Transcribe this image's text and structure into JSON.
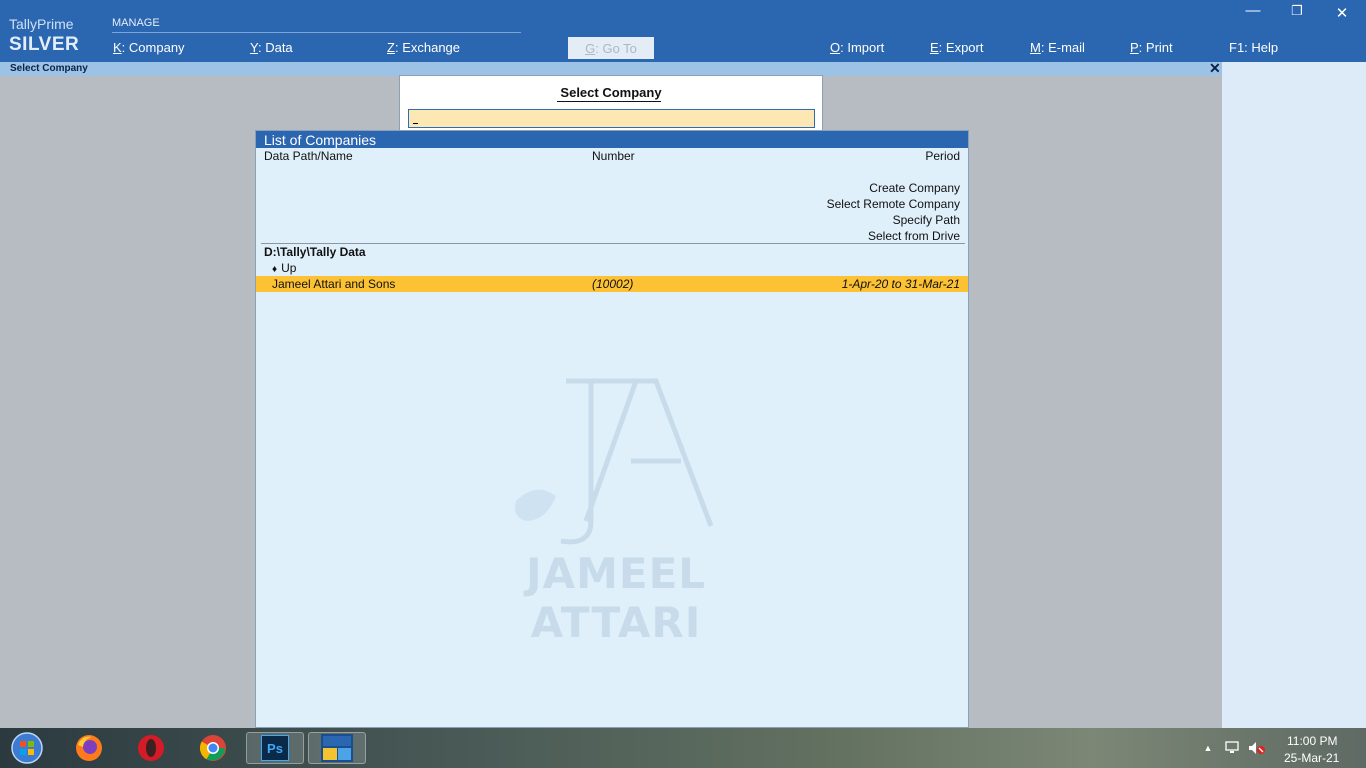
{
  "brand": {
    "product": "TallyPrime",
    "edition": "SILVER"
  },
  "topbar": {
    "section_label": "MANAGE",
    "menu": [
      {
        "key": "K",
        "label": "Company"
      },
      {
        "key": "Y",
        "label": "Data"
      },
      {
        "key": "Z",
        "label": "Exchange"
      },
      {
        "key": "G",
        "label": "Go To"
      },
      {
        "key": "O",
        "label": "Import"
      },
      {
        "key": "E",
        "label": "Export"
      },
      {
        "key": "M",
        "label": "E-mail"
      },
      {
        "key": "P",
        "label": "Print"
      },
      {
        "key": "F1",
        "label": "Help"
      }
    ],
    "window_controls": {
      "minimize": "—",
      "restore": "❐",
      "close": "✕"
    }
  },
  "title_strip": {
    "text": "Select Company",
    "close": "✕"
  },
  "select_company": {
    "title": "Select Company",
    "input_value": ""
  },
  "list": {
    "header": "List of Companies",
    "columns": {
      "name": "Data Path/Name",
      "number": "Number",
      "period": "Period"
    },
    "actions": [
      "Create Company",
      "Select Remote Company",
      "Specify Path",
      "Select from Drive"
    ],
    "data_path": "D:\\Tally\\Tally Data",
    "up_label": "Up",
    "companies": [
      {
        "name": "Jameel Attari and Sons",
        "number": "(10002)",
        "period": "1-Apr-20 to 31-Mar-21"
      }
    ]
  },
  "watermark": {
    "text": "JAMEEL ATTARI",
    "monogram": "JA"
  },
  "taskbar": {
    "apps": [
      "start-orb-icon",
      "firefox-icon",
      "opera-icon",
      "chrome-icon",
      "photoshop-icon",
      "tally-icon"
    ],
    "photoshop_label": "Ps",
    "time": "11:00 PM",
    "date": "25-Mar-21"
  },
  "colors": {
    "header_blue": "#2b66b1",
    "highlight_row": "#fcc233",
    "input_bg": "#fde8b3",
    "panel_bg": "#dff0fb"
  }
}
